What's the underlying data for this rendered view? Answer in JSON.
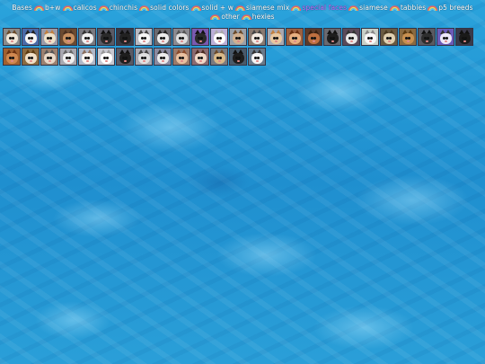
{
  "nav": {
    "items": [
      {
        "label": "Bases",
        "active": false
      },
      {
        "label": "b+w",
        "active": false
      },
      {
        "label": "calicos",
        "active": false
      },
      {
        "label": "chinchis",
        "active": false
      },
      {
        "label": "solid colors",
        "active": false
      },
      {
        "label": "solid + w",
        "active": false
      },
      {
        "label": "siamese mix",
        "active": false
      },
      {
        "label": "special faces",
        "active": true
      },
      {
        "label": "siamese",
        "active": false
      },
      {
        "label": "tabbies",
        "active": false
      },
      {
        "label": "p5 breeds",
        "active": false
      },
      {
        "label": "other",
        "active": false
      },
      {
        "label": "hexies",
        "active": false
      }
    ]
  },
  "colors": {
    "active_link": "#c86cff",
    "link": "#ffffff",
    "water": "#1f8fcf"
  },
  "icons": {
    "separator": "rainbow-icon",
    "tile": "cat-face-icon"
  },
  "gallery": {
    "row1": [
      {
        "bg": "#8a8a8a",
        "face": "#f0e6d8",
        "ear": "#6b4a2a"
      },
      {
        "bg": "#4a6aa8",
        "face": "#f4f4f4",
        "ear": "#222"
      },
      {
        "bg": "#9a9aa8",
        "face": "#ede0c8",
        "ear": "#c08040"
      },
      {
        "bg": "#6a4a30",
        "face": "#c89060",
        "ear": "#4a3020"
      },
      {
        "bg": "#7a7a80",
        "face": "#eeeeee",
        "ear": "#333"
      },
      {
        "bg": "#5a5a64",
        "face": "#2a2a2a",
        "ear": "#111"
      },
      {
        "bg": "#3a3a44",
        "face": "#222",
        "ear": "#111"
      },
      {
        "bg": "#b8b8c0",
        "face": "#f6f6f6",
        "ear": "#444"
      },
      {
        "bg": "#6a6a70",
        "face": "#ececec",
        "ear": "#222"
      },
      {
        "bg": "#8a8a90",
        "face": "#dedede",
        "ear": "#555"
      },
      {
        "bg": "#7a5ab0",
        "face": "#2a2a2a",
        "ear": "#111"
      },
      {
        "bg": "#bcb0d8",
        "face": "#ffffff",
        "ear": "#aaa"
      },
      {
        "bg": "#9aa0a8",
        "face": "#d0b090",
        "ear": "#6a4a2a"
      },
      {
        "bg": "#8a7a70",
        "face": "#f0e8e0",
        "ear": "#444"
      },
      {
        "bg": "#a8a8b0",
        "face": "#e8c8a0",
        "ear": "#c08040"
      },
      {
        "bg": "#9a6040",
        "face": "#e8b080",
        "ear": "#6a3010"
      },
      {
        "bg": "#5a3a2a",
        "face": "#c07040",
        "ear": "#3a2010"
      },
      {
        "bg": "#6a6a70",
        "face": "#1e1e1e",
        "ear": "#111"
      },
      {
        "bg": "#5a4a5a",
        "face": "#e8e8e8",
        "ear": "#333"
      },
      {
        "bg": "#c8d0c8",
        "face": "#f8f8f8",
        "ear": "#888"
      },
      {
        "bg": "#6a5a40",
        "face": "#e0d0b0",
        "ear": "#4a3a20"
      },
      {
        "bg": "#8a6a40",
        "face": "#c89050",
        "ear": "#5a3a10"
      },
      {
        "bg": "#5a5a60",
        "face": "#2e2e2e",
        "ear": "#111"
      },
      {
        "bg": "#6a5ab8",
        "face": "#ece8f8",
        "ear": "#333"
      },
      {
        "bg": "#3a3a4a",
        "face": "#1a1a1a",
        "ear": "#111"
      }
    ],
    "row2": [
      {
        "bg": "#a06030",
        "face": "#d08850",
        "ear": "#6a3010"
      },
      {
        "bg": "#8a6a40",
        "face": "#f0e0c8",
        "ear": "#5a3a10"
      },
      {
        "bg": "#9a8070",
        "face": "#e8d8c8",
        "ear": "#555"
      },
      {
        "bg": "#a8a8b0",
        "face": "#f0f0f0",
        "ear": "#666"
      },
      {
        "bg": "#b0b8c8",
        "face": "#f8f4f0",
        "ear": "#8a7060"
      },
      {
        "bg": "#c8c8d0",
        "face": "#ffffff",
        "ear": "#999"
      },
      {
        "bg": "#5a5a64",
        "face": "#1e1e1e",
        "ear": "#111"
      },
      {
        "bg": "#a8a8b0",
        "face": "#e0e0e0",
        "ear": "#444"
      },
      {
        "bg": "#8a8aa0",
        "face": "#ececec",
        "ear": "#333"
      },
      {
        "bg": "#9a7a6a",
        "face": "#e8c0a0",
        "ear": "#8a4a2a"
      },
      {
        "bg": "#8a6a70",
        "face": "#f0d8c8",
        "ear": "#4a2a20"
      },
      {
        "bg": "#7a7a80",
        "face": "#d8b888",
        "ear": "#6a4a2a"
      },
      {
        "bg": "#4a5a6a",
        "face": "#1e1e1e",
        "ear": "#111"
      },
      {
        "bg": "#6a7a8a",
        "face": "#f4f4f4",
        "ear": "#333"
      }
    ]
  }
}
